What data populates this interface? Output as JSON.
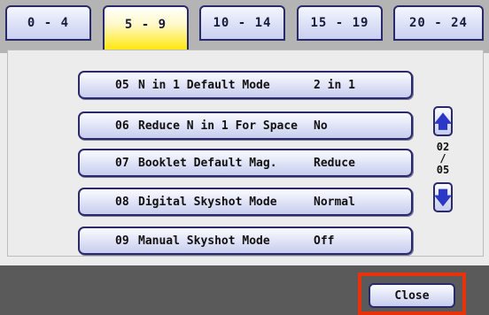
{
  "tabs": [
    {
      "label": "0 - 4"
    },
    {
      "label": "5 - 9"
    },
    {
      "label": "10 - 14"
    },
    {
      "label": "15 - 19"
    },
    {
      "label": "20 - 24"
    }
  ],
  "active_tab": "5 - 9",
  "settings": [
    {
      "num": "05",
      "name": "N in 1 Default Mode",
      "value": "2 in 1"
    },
    {
      "num": "06",
      "name": "Reduce N in 1 For Space",
      "value": "No"
    },
    {
      "num": "07",
      "name": "Booklet Default Mag.",
      "value": "Reduce"
    },
    {
      "num": "08",
      "name": "Digital Skyshot Mode",
      "value": "Normal"
    },
    {
      "num": "09",
      "name": "Manual Skyshot Mode",
      "value": "Off"
    }
  ],
  "pager": {
    "current": "02",
    "sep": "/",
    "total": "05"
  },
  "icons": {
    "up": "arrow-up-icon",
    "down": "arrow-down-icon"
  },
  "close_label": "Close",
  "colors": {
    "active_tab": "#ffe600",
    "highlight": "#e8320a",
    "arrow": "#2b38c6"
  }
}
